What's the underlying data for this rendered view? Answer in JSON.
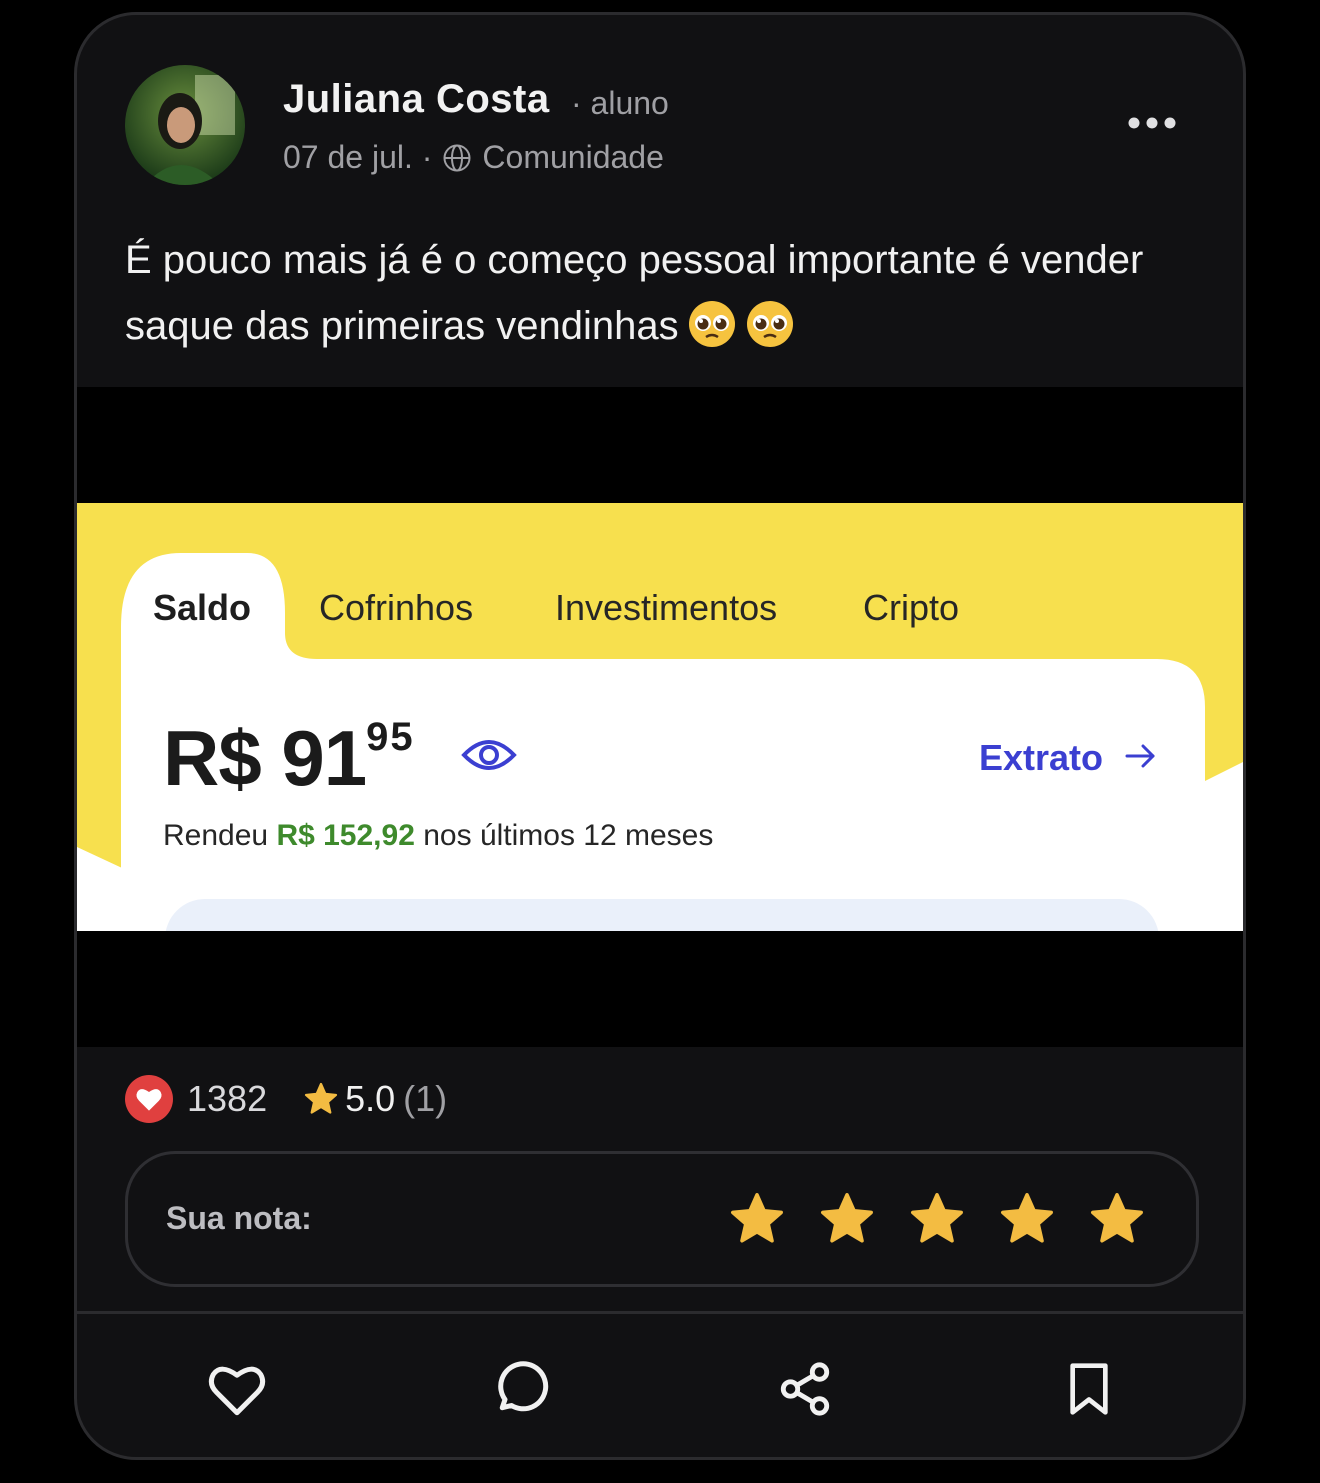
{
  "post": {
    "author": "Juliana Costa",
    "role": "· aluno",
    "date": "07 de jul. ·",
    "visibility": "Comunidade",
    "text": "É pouco mais já é o começo pessoal importante é vender saque das primeiras vendinhas",
    "emojis": [
      "pleading-face-emoji",
      "pleading-face-emoji"
    ]
  },
  "screenshot": {
    "tabs": [
      "Saldo",
      "Cofrinhos",
      "Investimentos",
      "Cripto"
    ],
    "balance_main": "R$ 91",
    "balance_cents": "95",
    "extrato_label": "Extrato",
    "rendeu_prefix": "Rendeu",
    "rendeu_amount": "R$ 152,92",
    "rendeu_suffix": "nos últimos 12 meses",
    "colors": {
      "yellow": "#f7e04e",
      "accent_blue": "#3b3fd1",
      "green": "#3e8a2c"
    }
  },
  "stats": {
    "likes": "1382",
    "rating": "5.0",
    "rating_count": "(1)"
  },
  "rate": {
    "label": "Sua nota:",
    "stars": 5
  },
  "actions": [
    "heart-icon",
    "comment-icon",
    "share-icon",
    "bookmark-icon"
  ],
  "colors": {
    "background": "#111113",
    "heart_red": "#e0403f",
    "star_gold": "#f3bc42"
  }
}
